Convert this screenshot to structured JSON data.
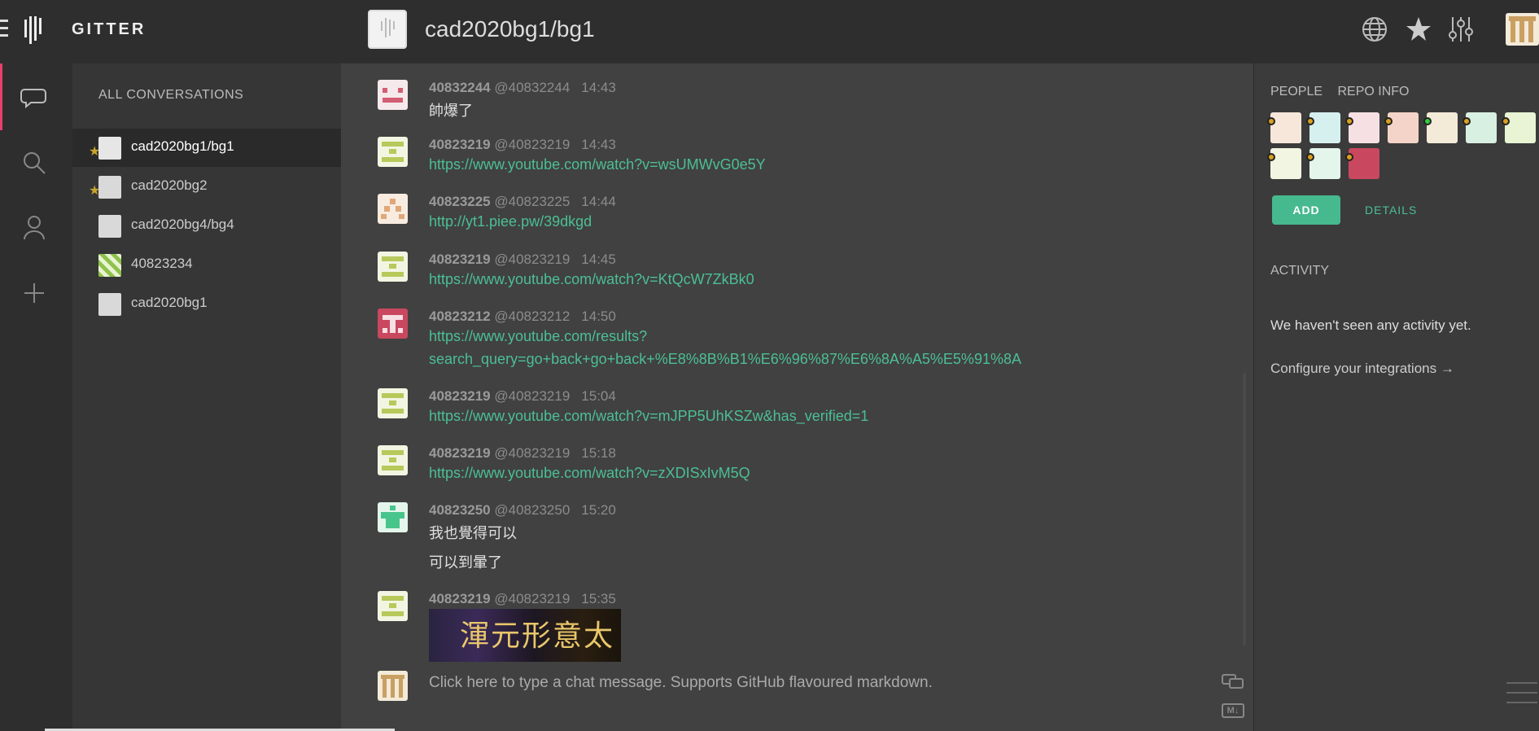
{
  "app": {
    "brand": "GITTER",
    "room_title": "cad2020bg1/bg1"
  },
  "conversations": {
    "header": "ALL CONVERSATIONS",
    "items": [
      {
        "name": "cad2020bg1/bg1",
        "starred": true,
        "active": true
      },
      {
        "name": "cad2020bg2",
        "starred": true,
        "active": false
      },
      {
        "name": "cad2020bg4/bg4",
        "starred": false,
        "active": false
      },
      {
        "name": "40823234",
        "starred": false,
        "active": false
      },
      {
        "name": "cad2020bg1",
        "starred": false,
        "active": false
      }
    ]
  },
  "messages": [
    {
      "user": "40832244",
      "handle": "@40832244",
      "time": "14:43",
      "lines": [
        "帥爆了"
      ],
      "link": false
    },
    {
      "user": "40823219",
      "handle": "@40823219",
      "time": "14:43",
      "lines": [
        "https://www.youtube.com/watch?v=wsUMWvG0e5Y"
      ],
      "link": true
    },
    {
      "user": "40823225",
      "handle": "@40823225",
      "time": "14:44",
      "lines": [
        "http://yt1.piee.pw/39dkgd"
      ],
      "link": true
    },
    {
      "user": "40823219",
      "handle": "@40823219",
      "time": "14:45",
      "lines": [
        "https://www.youtube.com/watch?v=KtQcW7ZkBk0"
      ],
      "link": true
    },
    {
      "user": "40823212",
      "handle": "@40823212",
      "time": "14:50",
      "lines": [
        "https://www.youtube.com/results?",
        "search_query=go+back+go+back+%E8%8B%B1%E6%96%87%E6%8A%A5%E5%91%8A"
      ],
      "link": true
    },
    {
      "user": "40823219",
      "handle": "@40823219",
      "time": "15:04",
      "lines": [
        "https://www.youtube.com/watch?v=mJPP5UhKSZw&has_verified=1"
      ],
      "link": true
    },
    {
      "user": "40823219",
      "handle": "@40823219",
      "time": "15:18",
      "lines": [
        "https://www.youtube.com/watch?v=zXDISxIvM5Q"
      ],
      "link": true
    },
    {
      "user": "40823250",
      "handle": "@40823250",
      "time": "15:20",
      "lines": [
        "我也覺得可以",
        "可以到暈了"
      ],
      "link": false
    },
    {
      "user": "40823219",
      "handle": "@40823219",
      "time": "15:35",
      "lines": [],
      "link": false
    }
  ],
  "image_text": "渾元形意太極",
  "compose_placeholder": "Click here to type a chat message. Supports GitHub flavoured markdown.",
  "sidebar": {
    "tab_people": "PEOPLE",
    "tab_repo": "REPO INFO",
    "add_label": "ADD",
    "details_label": "DETAILS",
    "activity_title": "ACTIVITY",
    "no_activity": "We haven't seen any activity yet.",
    "configure": "Configure your integrations →"
  },
  "icons": {
    "menu": "menu-icon",
    "logo": "gitter-logo-icon",
    "globe": "globe-icon",
    "star": "star-icon",
    "settings": "sliders-icon",
    "chat": "chat-icon",
    "search": "search-icon",
    "people": "person-icon",
    "add": "plus-icon",
    "compose_mode": "chat-bubbles-icon",
    "markdown": "markdown-icon"
  },
  "colors": {
    "accent": "#46b98e",
    "link": "#4bbf95",
    "active_indicator": "#e8406b",
    "star": "#c8a52b"
  }
}
